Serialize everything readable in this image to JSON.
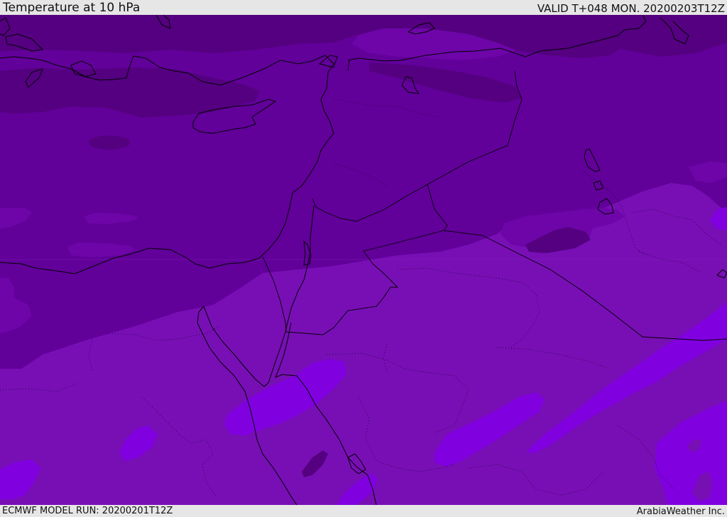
{
  "header": {
    "title": "Temperature at 10 hPa",
    "valid_time": "VALID T+048 MON. 20200203T12Z"
  },
  "footer": {
    "model_run": "ECMWF MODEL RUN: 20200201T12Z",
    "credit": "ArabiaWeather Inc."
  },
  "map": {
    "field": "temperature",
    "level": "10 hPa",
    "colors": {
      "darkest": "#540080",
      "dark": "#62009a",
      "mid_dark": "#6d05a8",
      "mid": "#780fb5",
      "bright": "#8000e0",
      "coastline": "#000000"
    }
  }
}
